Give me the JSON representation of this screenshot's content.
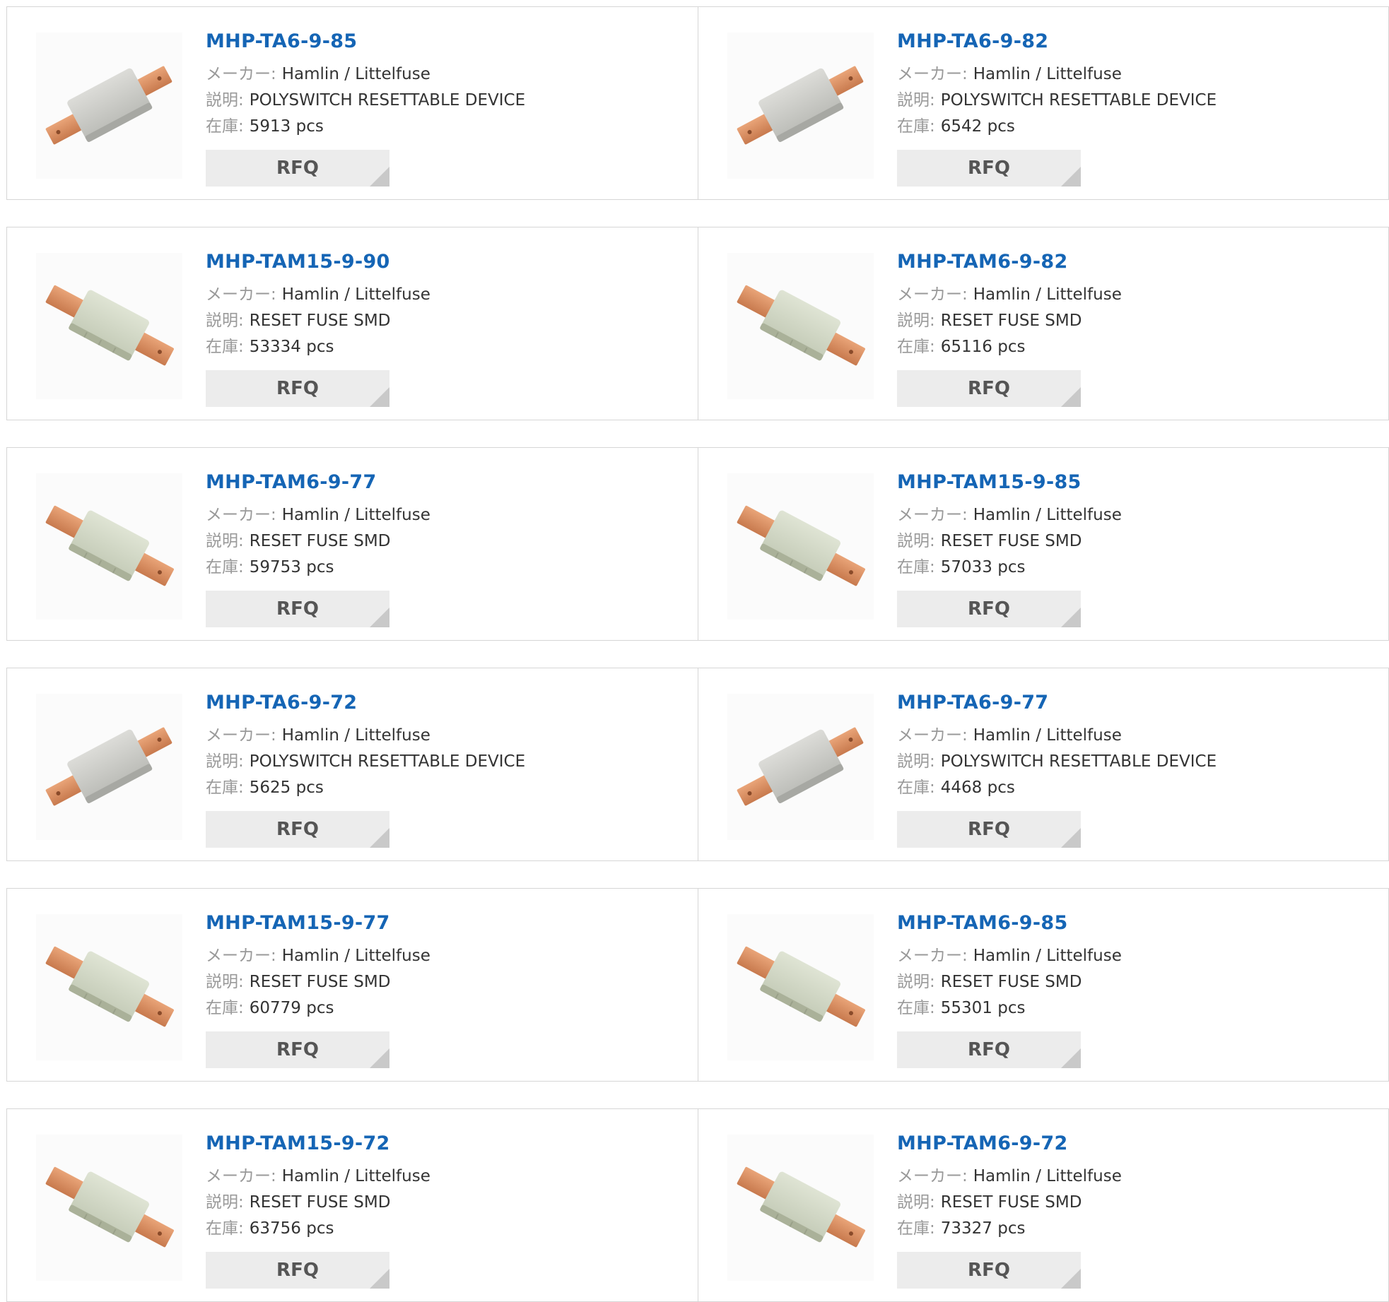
{
  "labels": {
    "maker": "メーカー:",
    "desc": "説明:",
    "stock": "在庫:",
    "rfq": "RFQ"
  },
  "colors": {
    "link": "#1565b5",
    "border": "#d6d6d6",
    "button_bg": "#ececec"
  },
  "products": [
    {
      "part": "MHP-TA6-9-85",
      "maker": "Hamlin / Littelfuse",
      "desc": "POLYSWITCH RESETTABLE DEVICE",
      "stock": "5913 pcs",
      "image": "polyswitch-device-image"
    },
    {
      "part": "MHP-TA6-9-82",
      "maker": "Hamlin / Littelfuse",
      "desc": "POLYSWITCH RESETTABLE DEVICE",
      "stock": "6542 pcs",
      "image": "polyswitch-device-image"
    },
    {
      "part": "MHP-TAM15-9-90",
      "maker": "Hamlin / Littelfuse",
      "desc": "RESET FUSE SMD",
      "stock": "53334 pcs",
      "image": "reset-fuse-image"
    },
    {
      "part": "MHP-TAM6-9-82",
      "maker": "Hamlin / Littelfuse",
      "desc": "RESET FUSE SMD",
      "stock": "65116 pcs",
      "image": "reset-fuse-image"
    },
    {
      "part": "MHP-TAM6-9-77",
      "maker": "Hamlin / Littelfuse",
      "desc": "RESET FUSE SMD",
      "stock": "59753 pcs",
      "image": "reset-fuse-image"
    },
    {
      "part": "MHP-TAM15-9-85",
      "maker": "Hamlin / Littelfuse",
      "desc": "RESET FUSE SMD",
      "stock": "57033 pcs",
      "image": "reset-fuse-image"
    },
    {
      "part": "MHP-TA6-9-72",
      "maker": "Hamlin / Littelfuse",
      "desc": "POLYSWITCH RESETTABLE DEVICE",
      "stock": "5625 pcs",
      "image": "polyswitch-device-image"
    },
    {
      "part": "MHP-TA6-9-77",
      "maker": "Hamlin / Littelfuse",
      "desc": "POLYSWITCH RESETTABLE DEVICE",
      "stock": "4468 pcs",
      "image": "polyswitch-device-image"
    },
    {
      "part": "MHP-TAM15-9-77",
      "maker": "Hamlin / Littelfuse",
      "desc": "RESET FUSE SMD",
      "stock": "60779 pcs",
      "image": "reset-fuse-image"
    },
    {
      "part": "MHP-TAM6-9-85",
      "maker": "Hamlin / Littelfuse",
      "desc": "RESET FUSE SMD",
      "stock": "55301 pcs",
      "image": "reset-fuse-image"
    },
    {
      "part": "MHP-TAM15-9-72",
      "maker": "Hamlin / Littelfuse",
      "desc": "RESET FUSE SMD",
      "stock": "63756 pcs",
      "image": "reset-fuse-image"
    },
    {
      "part": "MHP-TAM6-9-72",
      "maker": "Hamlin / Littelfuse",
      "desc": "RESET FUSE SMD",
      "stock": "73327 pcs",
      "image": "reset-fuse-image"
    }
  ]
}
